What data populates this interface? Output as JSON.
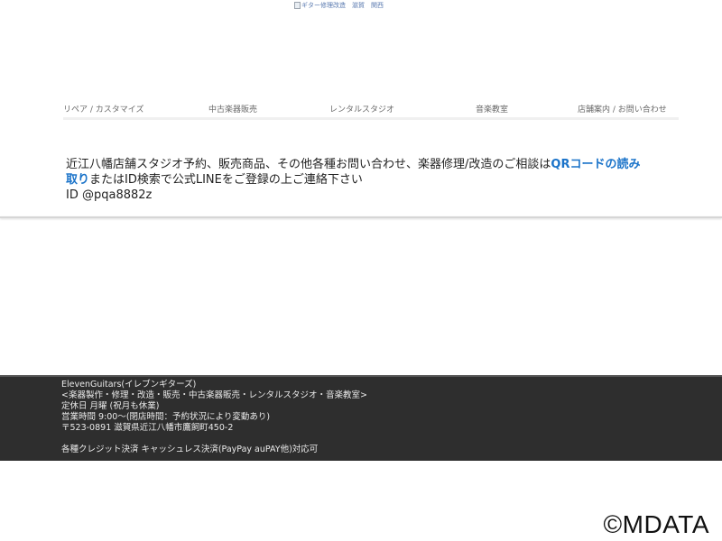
{
  "header": {
    "logo_alt": "ギター修理改造　滋賀　関西"
  },
  "nav": {
    "items": [
      {
        "label": "リペア / カスタマイズ"
      },
      {
        "label": "中古楽器販売"
      },
      {
        "label": "レンタルスタジオ"
      },
      {
        "label": "音楽教室"
      },
      {
        "label": "店舗案内 / お問い合わせ"
      }
    ]
  },
  "notice": {
    "text_before_link": "近江八幡店舗スタジオ予約、販売商品、その他各種お問い合わせ、楽器修理/改造のご相談は",
    "link_label": "QRコードの読み取り",
    "text_after_link": "またはID検索で公式LINEをご登録の上ご連絡下さい",
    "id_line": "ID @pqa8882z"
  },
  "footer": {
    "lines": [
      "ElevenGuitars(イレブンギターズ)",
      "<楽器製作・修理・改造・販売・中古楽器販売・レンタルスタジオ・音楽教室>",
      "定休日 月曜 (祝月も休業)",
      "営業時間 9:00～(閉店時間：予約状況により変動あり)",
      "〒523-0891 滋賀県近江八幡市鷹飼町450-2",
      "",
      "各種クレジット決済 キャッシュレス決済(PayPay auPAY他)対応可"
    ]
  },
  "watermark": {
    "text": "©MDATA"
  }
}
